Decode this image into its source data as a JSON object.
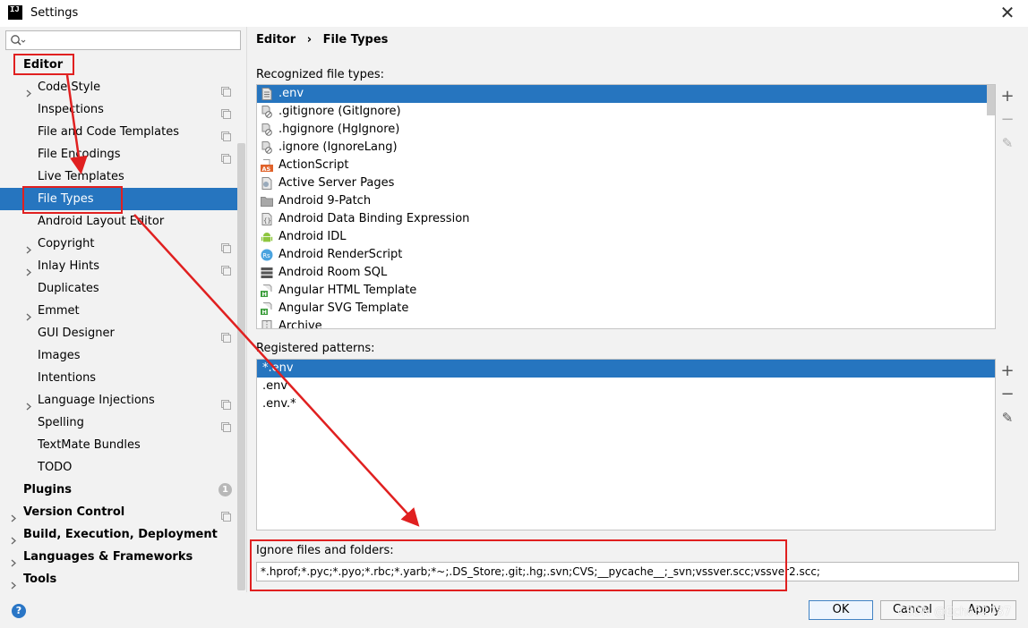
{
  "window": {
    "title": "Settings",
    "logo_text": "IJ",
    "close_symbol": "✕"
  },
  "search": {
    "placeholder": "",
    "value": ""
  },
  "sidebar": {
    "items": [
      {
        "label": "Editor",
        "level": 0,
        "bold": true,
        "expandable": false,
        "copy": false
      },
      {
        "label": "Code Style",
        "level": 1,
        "bold": false,
        "expandable": true,
        "copy": true
      },
      {
        "label": "Inspections",
        "level": 1,
        "bold": false,
        "expandable": false,
        "copy": true
      },
      {
        "label": "File and Code Templates",
        "level": 1,
        "bold": false,
        "expandable": false,
        "copy": true
      },
      {
        "label": "File Encodings",
        "level": 1,
        "bold": false,
        "expandable": false,
        "copy": true
      },
      {
        "label": "Live Templates",
        "level": 1,
        "bold": false,
        "expandable": false,
        "copy": false
      },
      {
        "label": "File Types",
        "level": 1,
        "bold": false,
        "expandable": false,
        "copy": false,
        "selected": true
      },
      {
        "label": "Android Layout Editor",
        "level": 1,
        "bold": false,
        "expandable": false,
        "copy": false
      },
      {
        "label": "Copyright",
        "level": 1,
        "bold": false,
        "expandable": true,
        "copy": true
      },
      {
        "label": "Inlay Hints",
        "level": 1,
        "bold": false,
        "expandable": true,
        "copy": true
      },
      {
        "label": "Duplicates",
        "level": 1,
        "bold": false,
        "expandable": false,
        "copy": false
      },
      {
        "label": "Emmet",
        "level": 1,
        "bold": false,
        "expandable": true,
        "copy": false
      },
      {
        "label": "GUI Designer",
        "level": 1,
        "bold": false,
        "expandable": false,
        "copy": true
      },
      {
        "label": "Images",
        "level": 1,
        "bold": false,
        "expandable": false,
        "copy": false
      },
      {
        "label": "Intentions",
        "level": 1,
        "bold": false,
        "expandable": false,
        "copy": false
      },
      {
        "label": "Language Injections",
        "level": 1,
        "bold": false,
        "expandable": true,
        "copy": true
      },
      {
        "label": "Spelling",
        "level": 1,
        "bold": false,
        "expandable": false,
        "copy": true
      },
      {
        "label": "TextMate Bundles",
        "level": 1,
        "bold": false,
        "expandable": false,
        "copy": false
      },
      {
        "label": "TODO",
        "level": 1,
        "bold": false,
        "expandable": false,
        "copy": false
      },
      {
        "label": "Plugins",
        "level": 0,
        "bold": true,
        "expandable": false,
        "copy": false,
        "badge": "1"
      },
      {
        "label": "Version Control",
        "level": 0,
        "bold": true,
        "expandable": true,
        "copy": true
      },
      {
        "label": "Build, Execution, Deployment",
        "level": 0,
        "bold": true,
        "expandable": true,
        "copy": false
      },
      {
        "label": "Languages & Frameworks",
        "level": 0,
        "bold": true,
        "expandable": true,
        "copy": false
      },
      {
        "label": "Tools",
        "level": 0,
        "bold": true,
        "expandable": true,
        "copy": false
      }
    ]
  },
  "breadcrumb": {
    "parent": "Editor",
    "separator": "›",
    "current": "File Types"
  },
  "recognized": {
    "label": "Recognized file types:",
    "items": [
      {
        "name": ".env",
        "icon": "text-file-icon",
        "selected": true
      },
      {
        "name": ".gitignore (GitIgnore)",
        "icon": "ignore-file-icon"
      },
      {
        "name": ".hgignore (HgIgnore)",
        "icon": "ignore-file-icon"
      },
      {
        "name": ".ignore (IgnoreLang)",
        "icon": "ignore-file-icon"
      },
      {
        "name": "ActionScript",
        "icon": "actionscript-icon",
        "icon_text": "AS"
      },
      {
        "name": "Active Server Pages",
        "icon": "asp-file-icon"
      },
      {
        "name": "Android 9-Patch",
        "icon": "folder-icon"
      },
      {
        "name": "Android Data Binding Expression",
        "icon": "binding-icon"
      },
      {
        "name": "Android IDL",
        "icon": "android-icon"
      },
      {
        "name": "Android RenderScript",
        "icon": "renderscript-icon",
        "icon_text": "Rs"
      },
      {
        "name": "Android Room SQL",
        "icon": "database-icon"
      },
      {
        "name": "Angular HTML Template",
        "icon": "html-template-icon",
        "icon_text": "H"
      },
      {
        "name": "Angular SVG Template",
        "icon": "html-template-icon",
        "icon_text": "H"
      },
      {
        "name": "Archive",
        "icon": "archive-icon"
      }
    ]
  },
  "registered": {
    "label": "Registered patterns:",
    "items": [
      {
        "name": "*.env",
        "selected": true
      },
      {
        "name": ".env"
      },
      {
        "name": ".env.*"
      }
    ]
  },
  "list_actions": {
    "add": "+",
    "remove": "−",
    "edit": "✎"
  },
  "ignore": {
    "label": "Ignore files and folders:",
    "value": "*.hprof;*.pyc;*.pyo;*.rbc;*.yarb;*~;.DS_Store;.git;.hg;.svn;CVS;__pycache__;_svn;vssver.scc;vssver2.scc;"
  },
  "footer": {
    "help": "?",
    "ok_label": "OK",
    "cancel_label": "Cancel",
    "apply_label": "Apply",
    "watermark": "CSDN @Echo52787"
  },
  "colors": {
    "selection": "#2675bf",
    "annotation": "#e02020",
    "panel": "#f2f2f2"
  }
}
